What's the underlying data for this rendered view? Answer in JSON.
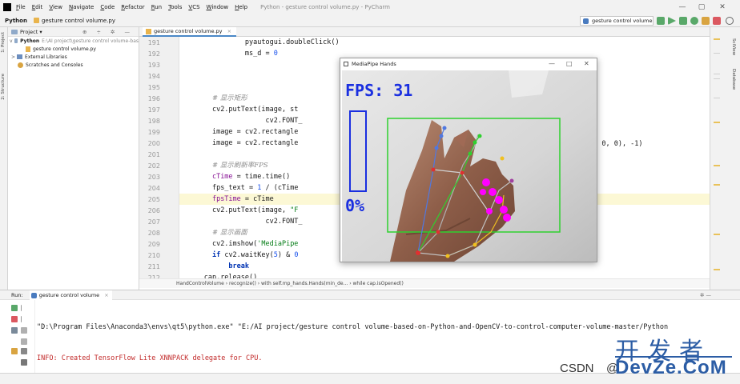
{
  "menubar": {
    "items": [
      "File",
      "Edit",
      "View",
      "Navigate",
      "Code",
      "Refactor",
      "Run",
      "Tools",
      "VCS",
      "Window",
      "Help"
    ],
    "window_title": "Python - gesture control volume.py - PyCharm",
    "minimize": "—",
    "maximize": "▢",
    "close": "✕"
  },
  "navbar": {
    "project": "Python",
    "file": "gesture control volume.py",
    "run_config": "gesture control volume"
  },
  "left_strip": {
    "project_tab": "1: Project",
    "structure_tab": "2: Structure"
  },
  "project_panel": {
    "title": "Project",
    "toolbar_icons": "⊕ ÷ ✲ —",
    "root_name": "Python",
    "root_path": "E:\\AI project\\gesture control volume-bas",
    "file": "gesture control volume.py",
    "external_libraries": "External Libraries",
    "scratches": "Scratches and Consoles"
  },
  "editor": {
    "tab_label": "gesture control volume.py",
    "tab_close": "×",
    "line_numbers": [
      "191",
      "192",
      "193",
      "194",
      "195",
      "196",
      "197",
      "198",
      "199",
      "200",
      "201",
      "202",
      "203",
      "204",
      "205",
      "206",
      "207",
      "208",
      "209",
      "210",
      "211",
      "212"
    ],
    "code_lines": [
      {
        "indent": "                ",
        "parts": [
          {
            "t": "pyautogui.doubleClick()",
            "c": ""
          }
        ]
      },
      {
        "indent": "                ",
        "parts": [
          {
            "t": "ms_d = ",
            "c": ""
          },
          {
            "t": "0",
            "c": "num"
          }
        ]
      },
      {
        "indent": "",
        "parts": []
      },
      {
        "indent": "",
        "parts": []
      },
      {
        "indent": "",
        "parts": []
      },
      {
        "indent": "        ",
        "parts": [
          {
            "t": "# 显示矩形",
            "c": "cmt"
          }
        ]
      },
      {
        "indent": "        ",
        "parts": [
          {
            "t": "cv2.putText(image, st",
            "c": ""
          }
        ]
      },
      {
        "indent": "                     ",
        "parts": [
          {
            "t": "cv2.FONT_",
            "c": ""
          }
        ]
      },
      {
        "indent": "        ",
        "parts": [
          {
            "t": "image = cv2.rectangle",
            "c": ""
          }
        ]
      },
      {
        "indent": "        ",
        "parts": [
          {
            "t": "image = cv2.rectangle",
            "c": ""
          }
        ]
      },
      {
        "indent": "",
        "parts": []
      },
      {
        "indent": "        ",
        "parts": [
          {
            "t": "# 显示刷新率FPS",
            "c": "cmt"
          }
        ]
      },
      {
        "indent": "        ",
        "parts": [
          {
            "t": "cTime",
            "c": "var"
          },
          {
            "t": " = time.time()",
            "c": ""
          }
        ]
      },
      {
        "indent": "        ",
        "parts": [
          {
            "t": "fps_text = ",
            "c": ""
          },
          {
            "t": "1",
            "c": "num"
          },
          {
            "t": " / (cTime",
            "c": ""
          }
        ]
      },
      {
        "indent": "        ",
        "parts": [
          {
            "t": "fpsTime",
            "c": "var"
          },
          {
            "t": " = cTime",
            "c": ""
          }
        ]
      },
      {
        "indent": "        ",
        "parts": [
          {
            "t": "cv2.putText(image, ",
            "c": ""
          },
          {
            "t": "\"F",
            "c": "str"
          }
        ]
      },
      {
        "indent": "                     ",
        "parts": [
          {
            "t": "cv2.FONT_",
            "c": ""
          }
        ]
      },
      {
        "indent": "        ",
        "parts": [
          {
            "t": "# 显示画面",
            "c": "cmt"
          }
        ]
      },
      {
        "indent": "        ",
        "parts": [
          {
            "t": "cv2.imshow(",
            "c": ""
          },
          {
            "t": "'MediaPipe",
            "c": "str"
          }
        ]
      },
      {
        "indent": "        ",
        "parts": [
          {
            "t": "if",
            "c": "kw"
          },
          {
            "t": " cv2.waitKey(",
            "c": ""
          },
          {
            "t": "5",
            "c": "num"
          },
          {
            "t": ") & ",
            "c": ""
          },
          {
            "t": "0",
            "c": "num"
          }
        ]
      },
      {
        "indent": "            ",
        "parts": [
          {
            "t": "break",
            "c": "kw"
          }
        ]
      },
      {
        "indent": "      ",
        "parts": [
          {
            "t": "cap.release()",
            "c": ""
          }
        ]
      }
    ],
    "right_fragment": "5, 0, 0), -1)"
  },
  "breadcrumb": "HandControlVolume  ›  recognize()  ›  with self.mp_hands.Hands(min_de...  ›  while cap.isOpened()",
  "right_strip": {
    "scview_tab": "SciView",
    "database_tab": "Database"
  },
  "mediapipe_window": {
    "title": "MediaPipe Hands",
    "minimize": "—",
    "maximize": "□",
    "close": "✕",
    "fps_label": "FPS: 31",
    "volume_label": "0%",
    "volume_level_percent": 0
  },
  "run_panel": {
    "label": "Run:",
    "tab": "gesture control volume",
    "console_line_1": "\"D:\\Program Files\\Anaconda3\\envs\\qt5\\python.exe\" \"E:/AI project/gesture control volume-based-on-Python-and-OpenCV-to-control-computer-volume-master/Python",
    "console_line_2": "INFO: Created TensorFlow Lite XNNPACK delegate for CPU."
  },
  "watermark": {
    "csdn": "CSDN",
    "at": "@",
    "cn": "开发者",
    "brand": "DevZe.CoM"
  },
  "colors": {
    "accent_blue": "#4a88c7",
    "fps_blue": "#1a2fe0",
    "hand_box_green": "#2ed12e",
    "keypoint_magenta": "#ff00ff",
    "console_error_red": "#c22a2a",
    "watermark_blue": "#2c5da5"
  }
}
